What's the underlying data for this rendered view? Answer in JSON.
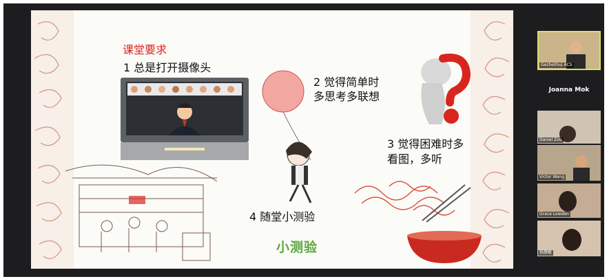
{
  "slide": {
    "title": "课堂要求",
    "item1": "1 总是打开摄像头",
    "item2_line1": "2 觉得简单时",
    "item2_line2": "多思考多联想",
    "item3_line1": "3 觉得困难时多",
    "item3_line2": "看图，多听",
    "item4": "4 随堂小测验",
    "quiz_label": "小测验"
  },
  "participants": {
    "host_label": "Gezhelihui ACS",
    "name_only": "Joanna Mok",
    "tiles": [
      {
        "label": "Daniel Zou"
      },
      {
        "label": "Victor Wang"
      },
      {
        "label": "Grace Lowden"
      },
      {
        "label": "杨惠敏"
      }
    ]
  },
  "colors": {
    "accent_red": "#d8261f",
    "accent_green": "#5aa83a",
    "window_dark": "#1d1d1f"
  }
}
